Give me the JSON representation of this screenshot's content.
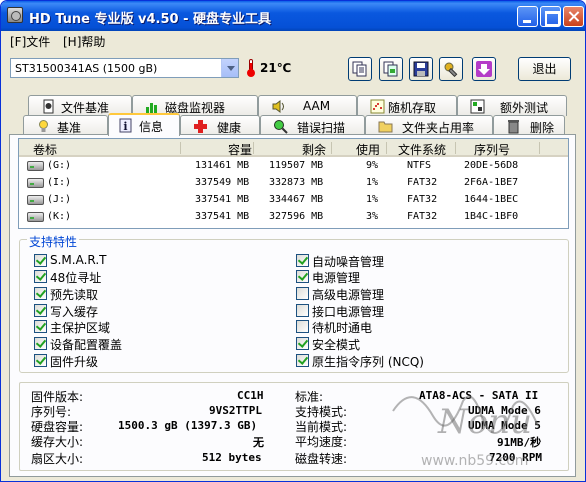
{
  "window": {
    "title": "HD Tune 专业版 v4.50 - 硬盘专业工具"
  },
  "menu": [
    "[F]文件",
    "[H]帮助"
  ],
  "toolbar": {
    "drive": "ST31500341AS (1500 gB)",
    "temperature": "21℃",
    "exit_label": "退出"
  },
  "tabs_row1": [
    "文件基准",
    "磁盘监视器",
    "AAM",
    "随机存取",
    "额外测试"
  ],
  "tabs_row2": [
    "基准",
    "信息",
    "健康",
    "错误扫描",
    "文件夹占用率",
    "删除"
  ],
  "active_tab": "信息",
  "partitions": {
    "headers": [
      "卷标",
      "容量",
      "剩余",
      "使用",
      "文件系统",
      "序列号"
    ],
    "rows": [
      [
        "(G:)",
        "131461 MB",
        "119507 MB",
        "9%",
        "NTFS",
        "20DE-56D8"
      ],
      [
        "(I:)",
        "337549 MB",
        "332873 MB",
        "1%",
        "FAT32",
        "2F6A-1BE7"
      ],
      [
        "(J:)",
        "337541 MB",
        "334467 MB",
        "1%",
        "FAT32",
        "1644-1BEC"
      ],
      [
        "(K:)",
        "337541 MB",
        "327596 MB",
        "3%",
        "FAT32",
        "1B4C-1BF0"
      ]
    ]
  },
  "features": {
    "title": "支持特性",
    "left": [
      {
        "label": "S.M.A.R.T",
        "checked": true
      },
      {
        "label": "48位寻址",
        "checked": true
      },
      {
        "label": "预先读取",
        "checked": true
      },
      {
        "label": "写入缓存",
        "checked": true
      },
      {
        "label": "主保护区域",
        "checked": true
      },
      {
        "label": "设备配置覆盖",
        "checked": true
      },
      {
        "label": "固件升级",
        "checked": true
      }
    ],
    "right": [
      {
        "label": "自动噪音管理",
        "checked": true
      },
      {
        "label": "电源管理",
        "checked": true
      },
      {
        "label": "高级电源管理",
        "checked": false
      },
      {
        "label": "接口电源管理",
        "checked": false
      },
      {
        "label": "待机时通电",
        "checked": false
      },
      {
        "label": "安全模式",
        "checked": true
      },
      {
        "label": "原生指令序列 (NCQ)",
        "checked": true
      }
    ]
  },
  "drive_info": {
    "left": [
      {
        "label": "固件版本:",
        "value": "CC1H"
      },
      {
        "label": "序列号:",
        "value": "9VS2TTPL"
      },
      {
        "label": "硬盘容量:",
        "value": "1500.3 gB (1397.3 GB)"
      },
      {
        "label": "缓存大小:",
        "value": "无"
      },
      {
        "label": "扇区大小:",
        "value": "512 bytes"
      }
    ],
    "right": [
      {
        "label": "标准:",
        "value": "ATA8-ACS - SATA II"
      },
      {
        "label": "支持模式:",
        "value": "UDMA Mode 6"
      },
      {
        "label": "当前模式:",
        "value": "UDMA Mode 5"
      },
      {
        "label": "平均速度:",
        "value": "91MB/秒"
      },
      {
        "label": "磁盘转速:",
        "value": "7200 RPM"
      }
    ]
  },
  "watermark": {
    "script": "Nonu",
    "url": "www.nb59.com"
  },
  "colors": {
    "titlebar": "#0550D6",
    "group_title": "#0046D5",
    "check": "#21A121",
    "active_tab_top": "#FFC83C"
  }
}
